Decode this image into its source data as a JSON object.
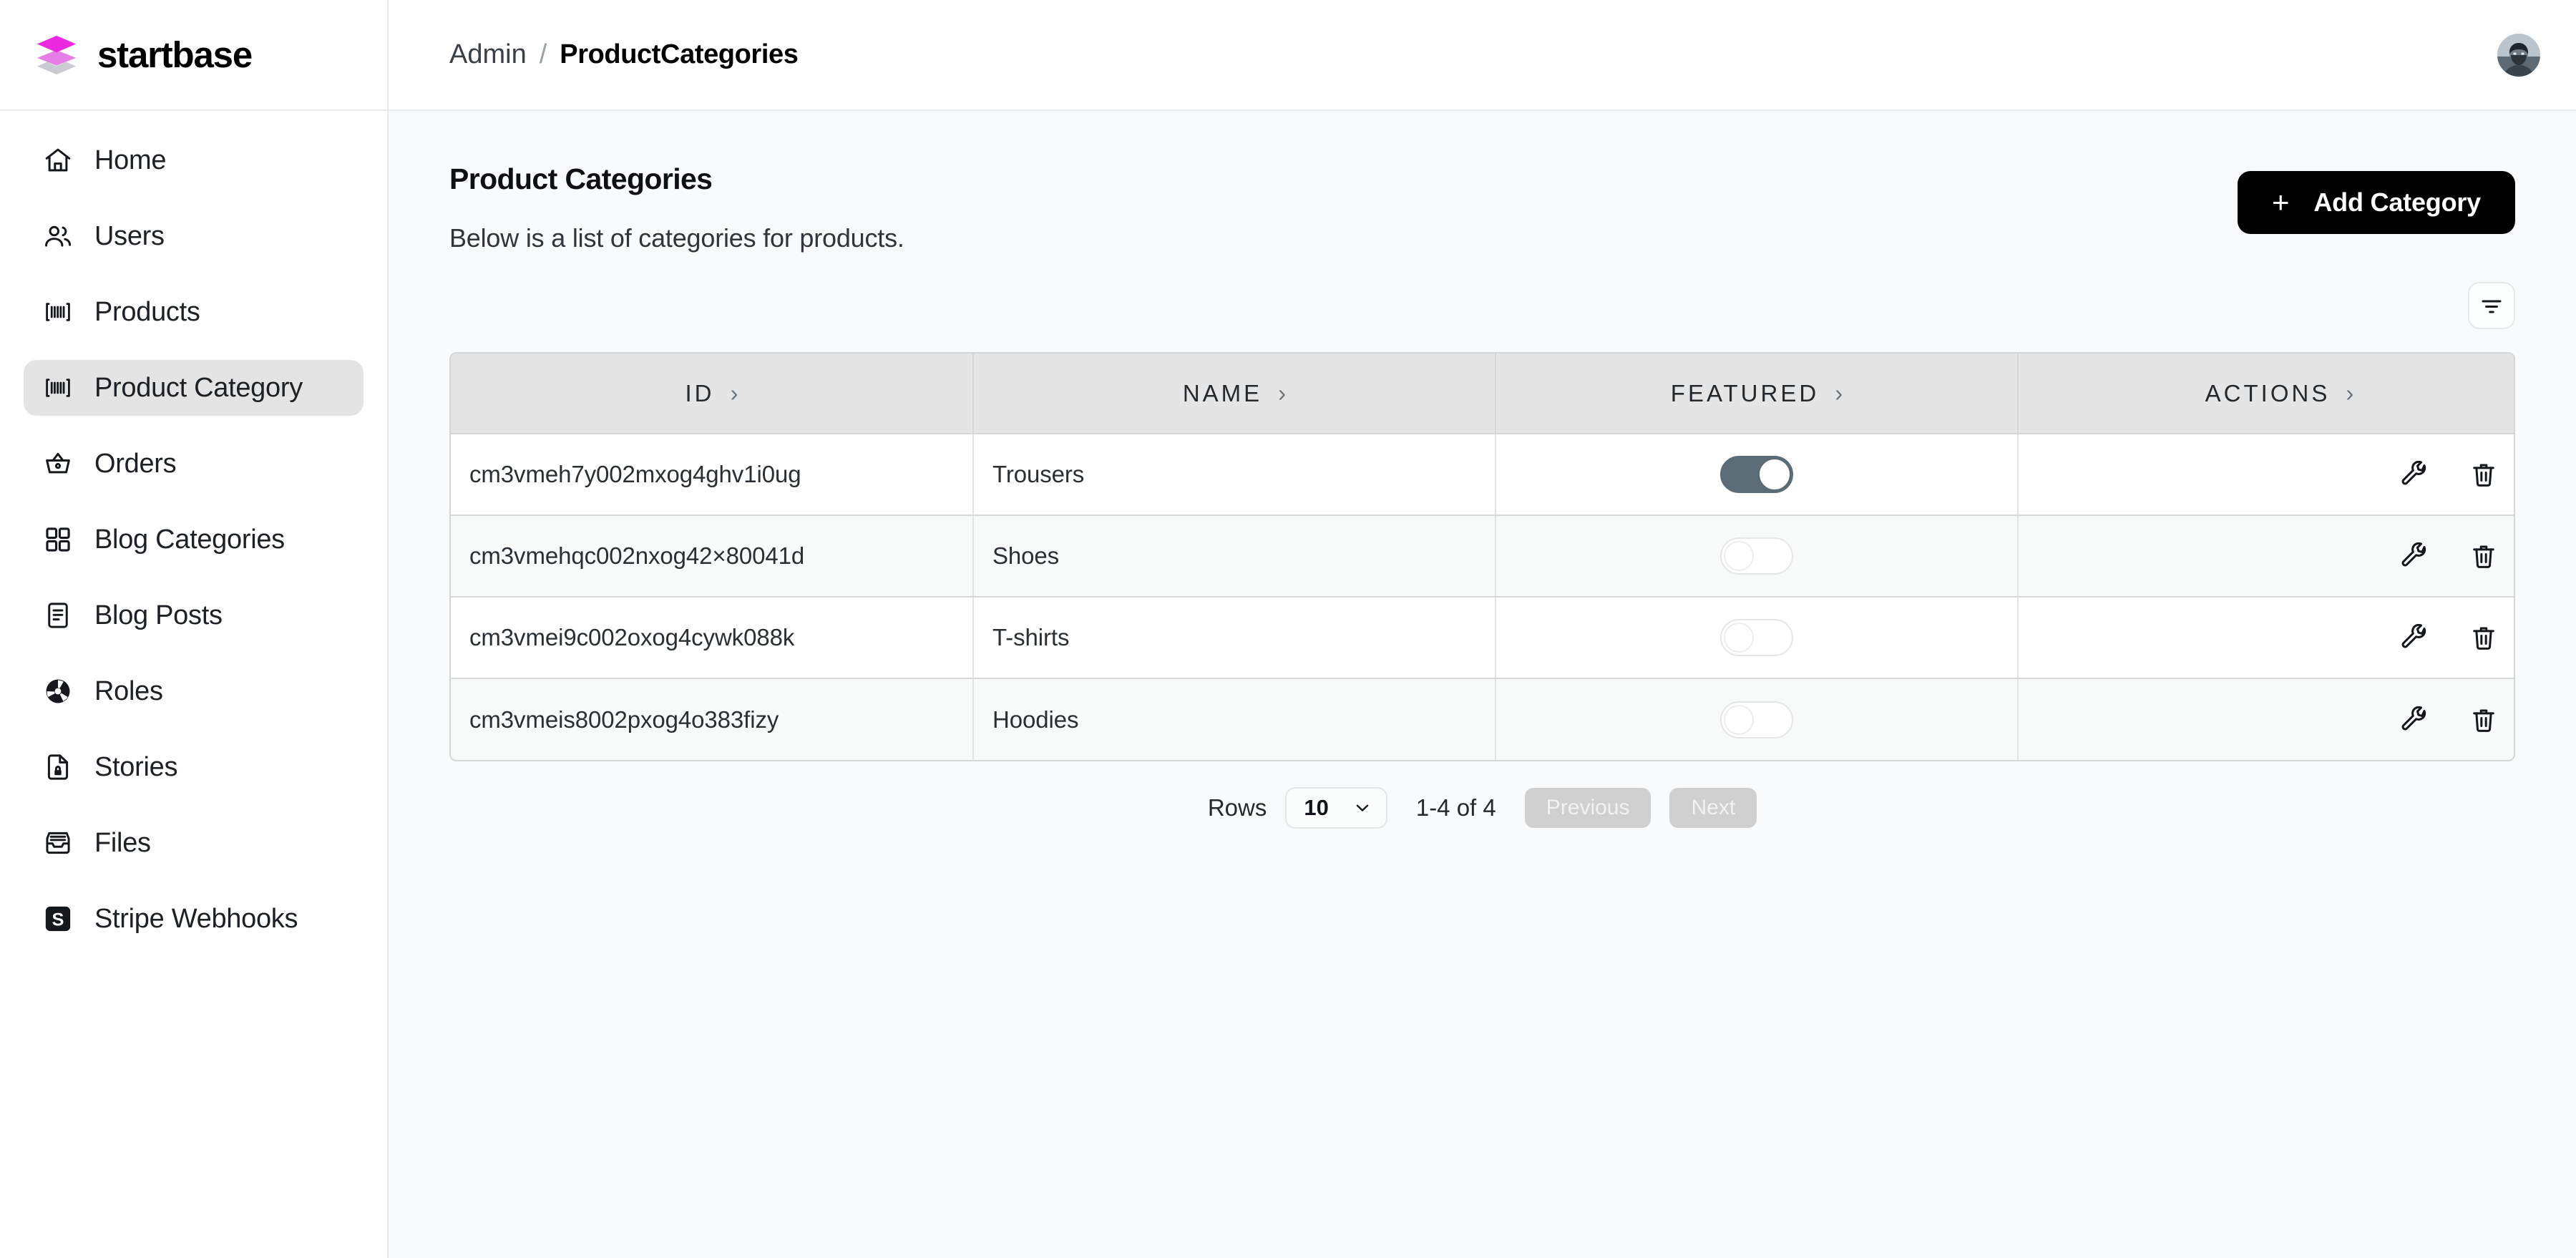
{
  "brand": {
    "name": "startbase",
    "logo_icon": "layers-icon",
    "logo_color": "#ea28e0"
  },
  "sidebar": {
    "items": [
      {
        "label": "Home",
        "icon": "home-icon",
        "active": false
      },
      {
        "label": "Users",
        "icon": "users-icon",
        "active": false
      },
      {
        "label": "Products",
        "icon": "barcode-icon",
        "active": false
      },
      {
        "label": "Product Category",
        "icon": "barcode-icon",
        "active": true
      },
      {
        "label": "Orders",
        "icon": "basket-icon",
        "active": false
      },
      {
        "label": "Blog Categories",
        "icon": "grid-icon",
        "active": false
      },
      {
        "label": "Blog Posts",
        "icon": "document-icon",
        "active": false
      },
      {
        "label": "Roles",
        "icon": "radiation-icon",
        "active": false
      },
      {
        "label": "Stories",
        "icon": "file-lock-icon",
        "active": false
      },
      {
        "label": "Files",
        "icon": "inbox-icon",
        "active": false
      },
      {
        "label": "Stripe Webhooks",
        "icon": "stripe-icon",
        "active": false
      }
    ]
  },
  "topbar": {
    "breadcrumb": {
      "root": "Admin",
      "separator": "/",
      "current": "ProductCategories"
    },
    "avatar_icon": "avatar"
  },
  "page": {
    "title": "Product Categories",
    "description": "Below is a list of categories for products.",
    "add_button": {
      "label": "Add Category",
      "plus": "+",
      "bg_color": "#000000"
    },
    "filter_button_icon": "filter-icon"
  },
  "table": {
    "columns": [
      {
        "label": "ID",
        "chevron": "›"
      },
      {
        "label": "NAME",
        "chevron": "›"
      },
      {
        "label": "FEATURED",
        "chevron": "›"
      },
      {
        "label": "ACTIONS",
        "chevron": "›"
      }
    ],
    "rows": [
      {
        "id": "cm3vmeh7y002mxog4ghv1i0ug",
        "name": "Trousers",
        "featured": true
      },
      {
        "id": "cm3vmehqc002nxog42×80041d",
        "name": "Shoes",
        "featured": false
      },
      {
        "id": "cm3vmei9c002oxog4cywk088k",
        "name": "T-shirts",
        "featured": false
      },
      {
        "id": "cm3vmeis8002pxog4o383fizy",
        "name": "Hoodies",
        "featured": false
      }
    ],
    "row_actions": [
      {
        "icon": "wrench-icon",
        "name": "edit"
      },
      {
        "icon": "trash-icon",
        "name": "delete"
      }
    ],
    "toggle_on_color": "#5b6c76"
  },
  "pagination": {
    "rows_label": "Rows",
    "rows_per_page": "10",
    "range_text": "1-4 of 4",
    "previous_label": "Previous",
    "next_label": "Next",
    "previous_disabled": true,
    "next_disabled": true
  }
}
